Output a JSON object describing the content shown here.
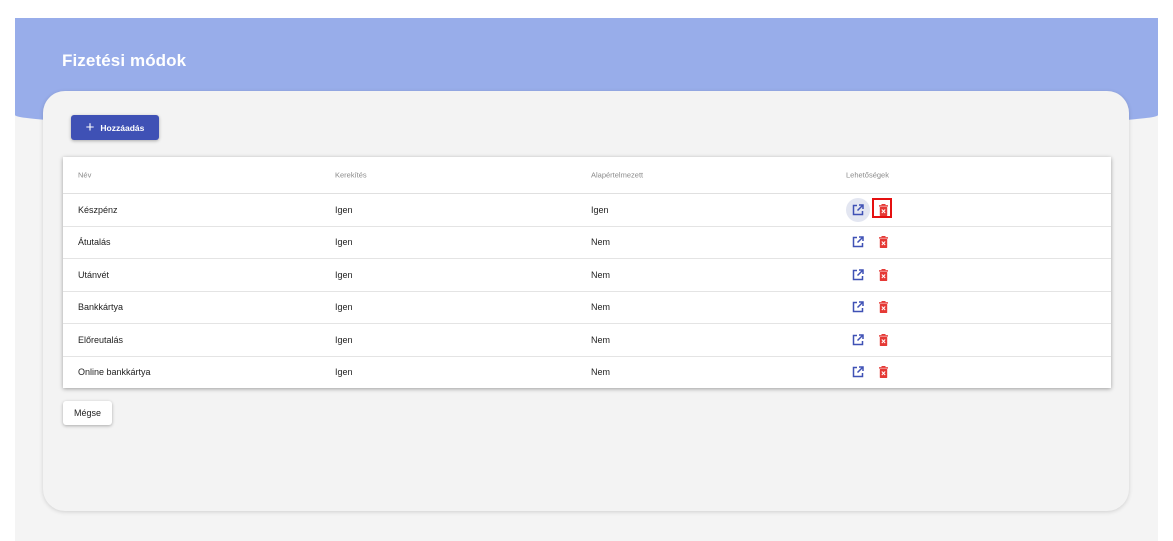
{
  "page": {
    "title": "Fizetési módok"
  },
  "toolbar": {
    "add_icon": "plus-icon",
    "add_label": "Hozzáadás"
  },
  "table": {
    "headers": [
      "Név",
      "Kerekítés",
      "Alapértelmezett",
      "Lehetőségek"
    ],
    "rows": [
      {
        "name": "Készpénz",
        "rounding": "Igen",
        "default": "Igen"
      },
      {
        "name": "Átutalás",
        "rounding": "Igen",
        "default": "Nem"
      },
      {
        "name": "Utánvét",
        "rounding": "Igen",
        "default": "Nem"
      },
      {
        "name": "Bankkártya",
        "rounding": "Igen",
        "default": "Nem"
      },
      {
        "name": "Előreutalás",
        "rounding": "Igen",
        "default": "Nem"
      },
      {
        "name": "Online bankkártya",
        "rounding": "Igen",
        "default": "Nem"
      }
    ],
    "action_icons": {
      "edit": "edit-icon",
      "delete": "trash-icon"
    }
  },
  "footer": {
    "cancel_label": "Mégse"
  },
  "colors": {
    "header_band": "#98adea",
    "primary_button": "#3f51b5",
    "edit_icon": "#3f51b5",
    "delete_icon": "#e53935",
    "highlight_box": "#e51010"
  }
}
